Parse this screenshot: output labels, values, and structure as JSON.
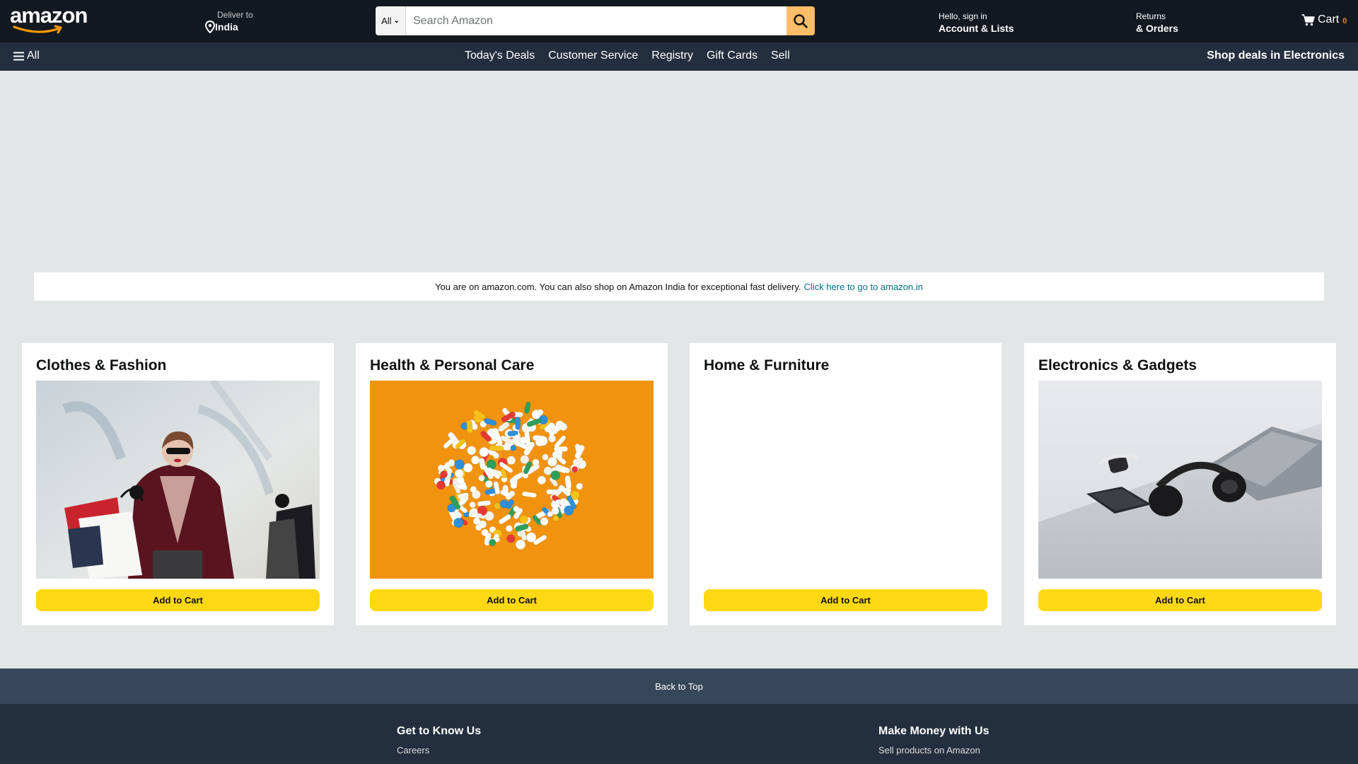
{
  "header": {
    "logo_text": "amazon",
    "deliver": {
      "line1": "Deliver to",
      "line2": "India"
    },
    "search": {
      "category": "All",
      "placeholder": "Search Amazon"
    },
    "account": {
      "line1": "Hello, sign in",
      "line2": "Account & Lists"
    },
    "returns": {
      "line1": "Returns",
      "line2": "& Orders"
    },
    "cart": {
      "label": "Cart",
      "count": "0"
    }
  },
  "nav": {
    "all_label": "All",
    "links": [
      "Today's Deals",
      "Customer Service",
      "Registry",
      "Gift Cards",
      "Sell"
    ],
    "promo": "Shop deals in Electronics"
  },
  "notice": {
    "text": "You are on amazon.com. You can also shop on Amazon India for exceptional fast delivery.",
    "link": "Click here to go to amazon.in"
  },
  "cards": [
    {
      "title": "Clothes & Fashion",
      "button": "Add to Cart"
    },
    {
      "title": "Health & Personal Care",
      "button": "Add to Cart"
    },
    {
      "title": "Home & Furniture",
      "button": "Add to Cart"
    },
    {
      "title": "Electronics & Gadgets",
      "button": "Add to Cart"
    }
  ],
  "footer": {
    "back_to_top": "Back to Top",
    "columns": [
      {
        "title": "Get to Know Us",
        "links": [
          "Careers"
        ]
      },
      {
        "title": "Make Money with Us",
        "links": [
          "Sell products on Amazon"
        ]
      }
    ]
  },
  "colors": {
    "header_bg": "#131921",
    "nav_bg": "#232f3e",
    "search_button": "#febd69",
    "add_to_cart": "#ffd814",
    "link": "#007185",
    "cart_count": "#f08804",
    "back_to_top_bg": "#37475a",
    "page_bg": "#e3e6e6"
  },
  "icons": [
    "location-pin-icon",
    "search-icon",
    "cart-icon",
    "hamburger-menu-icon",
    "chevron-down-icon"
  ]
}
